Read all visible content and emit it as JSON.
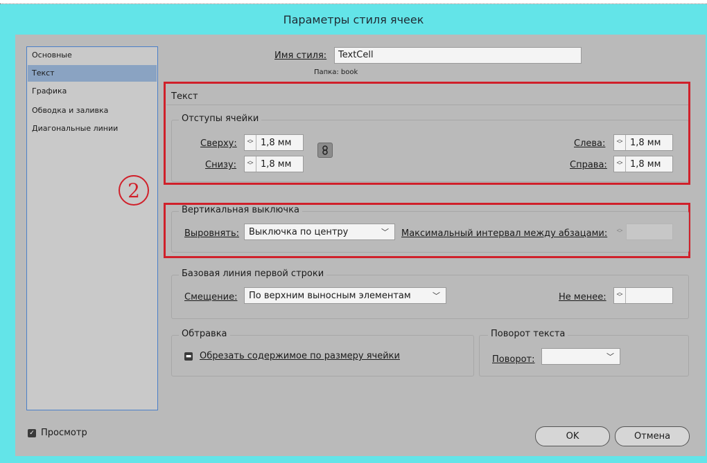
{
  "dialog": {
    "title": "Параметры стиля ячеек"
  },
  "sidebar": {
    "items": [
      {
        "label": "Основные"
      },
      {
        "label": "Текст"
      },
      {
        "label": "Графика"
      },
      {
        "label": "Обводка и заливка"
      },
      {
        "label": "Диагональные линии"
      }
    ]
  },
  "style": {
    "name_label": "Имя стиля:",
    "name_value": "TextCell",
    "folder": "Папка: book"
  },
  "section_title": "Текст",
  "insets": {
    "group_title": "Отступы ячейки",
    "top_label": "Сверху:",
    "top_value": "1,8 мм",
    "bottom_label": "Снизу:",
    "bottom_value": "1,8 мм",
    "left_label": "Слева:",
    "left_value": "1,8 мм",
    "right_label": "Справа:",
    "right_value": "1,8 мм"
  },
  "annotation": {
    "number": "2"
  },
  "vertical": {
    "group_title": "Вертикальная выключка",
    "align_label": "Выровнять:",
    "align_value": "Выключка по центру",
    "max_spacing_label": "Максимальный интервал между абзацами:"
  },
  "baseline": {
    "group_title": "Базовая линия первой строки",
    "offset_label": "Смещение:",
    "offset_value": "По верхним выносным элементам",
    "min_label": "Не менее:"
  },
  "clipping": {
    "group_title": "Обтравка",
    "checkbox_label": "Обрезать содержимое по размеру ячейки"
  },
  "rotation": {
    "group_title": "Поворот текста",
    "rotate_label": "Поворот:"
  },
  "footer": {
    "preview_label": "Просмотр",
    "ok_label": "OK",
    "cancel_label": "Отмена"
  },
  "colors": {
    "titlebar": "#63e4e8",
    "panel": "#bababa",
    "selection": "#8aa3c2",
    "highlight": "#d0202a"
  }
}
